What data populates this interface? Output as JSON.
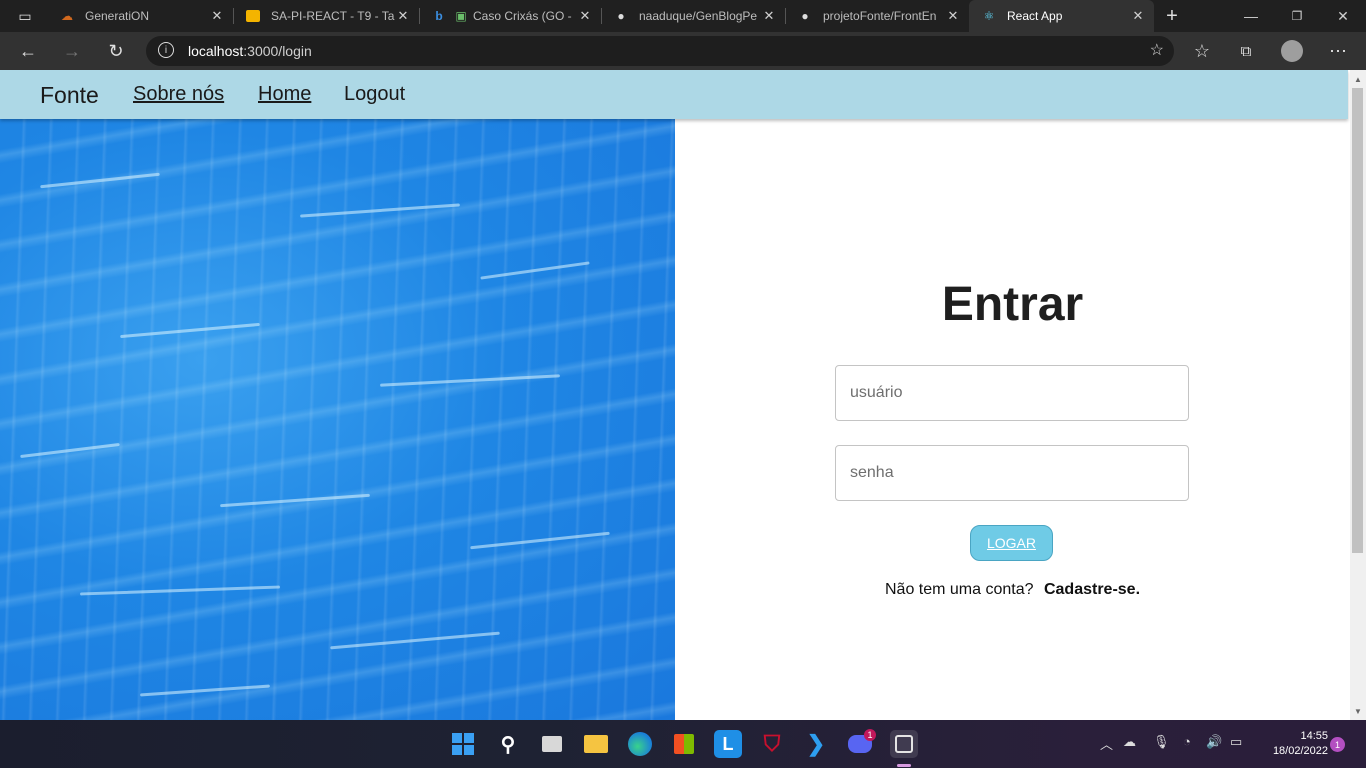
{
  "browser": {
    "tabs": [
      {
        "title": "GeneratiON",
        "icon": "cloud-icon"
      },
      {
        "title": "SA-PI-REACT - T9 - Ta",
        "icon": "slides-icon"
      },
      {
        "title": "Caso Crixás (GO -",
        "icon": "bing-icon"
      },
      {
        "title": "naaduque/GenBlogPe",
        "icon": "github-icon"
      },
      {
        "title": "projetoFonte/FrontEn",
        "icon": "github-icon"
      },
      {
        "title": "React App",
        "icon": "react-icon"
      }
    ],
    "url_host": "localhost",
    "url_path": ":3000/login"
  },
  "navbar": {
    "brand": "Fonte",
    "links": [
      "Sobre nós",
      "Home",
      "Logout"
    ]
  },
  "login": {
    "title": "Entrar",
    "username_placeholder": "usuário",
    "password_placeholder": "senha",
    "submit_label": "LOGAR",
    "signup_prompt": "Não tem uma conta?",
    "signup_link": "Cadastre-se."
  },
  "taskbar": {
    "time": "14:55",
    "date": "18/02/2022",
    "discord_badge": "1",
    "notification_count": "1"
  },
  "colors": {
    "navbar_bg": "#add8e6",
    "button_bg": "#6fcbe6",
    "water_blue": "#1f86e4"
  }
}
